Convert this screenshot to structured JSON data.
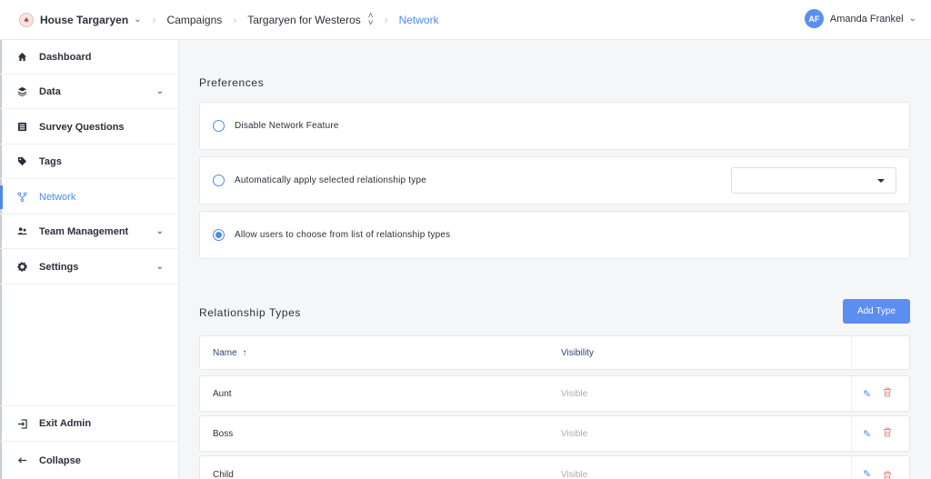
{
  "header": {
    "org": "House Targaryen",
    "breadcrumb": [
      "Campaigns",
      "Targaryen for Westeros",
      "Network"
    ],
    "user": {
      "initials": "AF",
      "name": "Amanda Frankel"
    }
  },
  "sidebar": {
    "items": [
      {
        "label": "Dashboard",
        "icon": "home-icon"
      },
      {
        "label": "Data",
        "icon": "layers-icon",
        "expandable": true
      },
      {
        "label": "Survey Questions",
        "icon": "list-icon"
      },
      {
        "label": "Tags",
        "icon": "tag-icon"
      },
      {
        "label": "Network",
        "icon": "network-icon",
        "active": true
      },
      {
        "label": "Team Management",
        "icon": "users-icon",
        "expandable": true
      },
      {
        "label": "Settings",
        "icon": "gear-icon",
        "expandable": true
      }
    ],
    "footer": [
      {
        "label": "Exit Admin",
        "icon": "exit-icon"
      },
      {
        "label": "Collapse",
        "icon": "arrow-left-icon"
      }
    ]
  },
  "preferences": {
    "title": "Preferences",
    "options": [
      {
        "label": "Disable Network Feature",
        "checked": false
      },
      {
        "label": "Automatically apply selected relationship type",
        "checked": false,
        "select_value": ""
      },
      {
        "label": "Allow users to choose from list of relationship types",
        "checked": true
      }
    ]
  },
  "relationship_types": {
    "title": "Relationship Types",
    "add_label": "Add Type",
    "columns": {
      "name": "Name",
      "visibility": "Visibility"
    },
    "rows": [
      {
        "name": "Aunt",
        "visibility": "Visible"
      },
      {
        "name": "Boss",
        "visibility": "Visible"
      },
      {
        "name": "Child",
        "visibility": "Visible"
      }
    ]
  },
  "colors": {
    "accent": "#4d8af0",
    "delete": "#e88b8b",
    "background": "#f5f6f8"
  }
}
